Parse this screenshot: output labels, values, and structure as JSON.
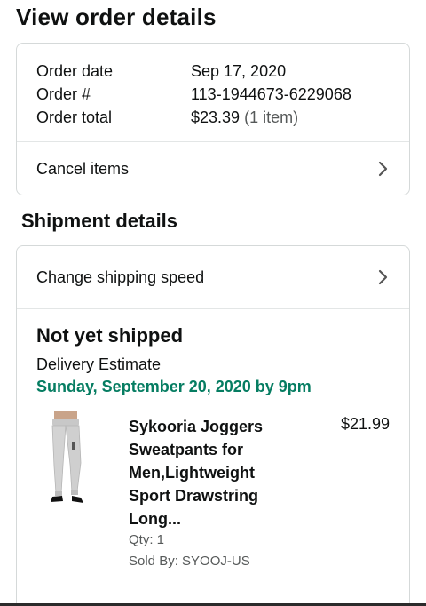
{
  "page": {
    "title": "View order details"
  },
  "order": {
    "rows": [
      {
        "label": "Order date",
        "value": "Sep 17, 2020"
      },
      {
        "label": "Order #",
        "value": "113-1944673-6229068"
      },
      {
        "label": "Order total",
        "value": "$23.39",
        "extra": "(1 item)"
      }
    ],
    "cancel_label": "Cancel items"
  },
  "shipment": {
    "section_title": "Shipment details",
    "change_speed_label": "Change shipping speed",
    "status": "Not yet shipped",
    "delivery_label": "Delivery Estimate",
    "delivery_date": "Sunday, September 20, 2020 by 9pm",
    "delivery_color": "#067d62",
    "item": {
      "title": "Sykooria Joggers Sweatpants for Men,Lightweight Sport Drawstring Long...",
      "price": "$21.99",
      "qty": "Qty: 1",
      "sold_by": "Sold By: SYOOJ-US",
      "image_icon": "jogger-pants-image"
    }
  },
  "icons": {
    "chevron": "chevron-right-icon"
  }
}
